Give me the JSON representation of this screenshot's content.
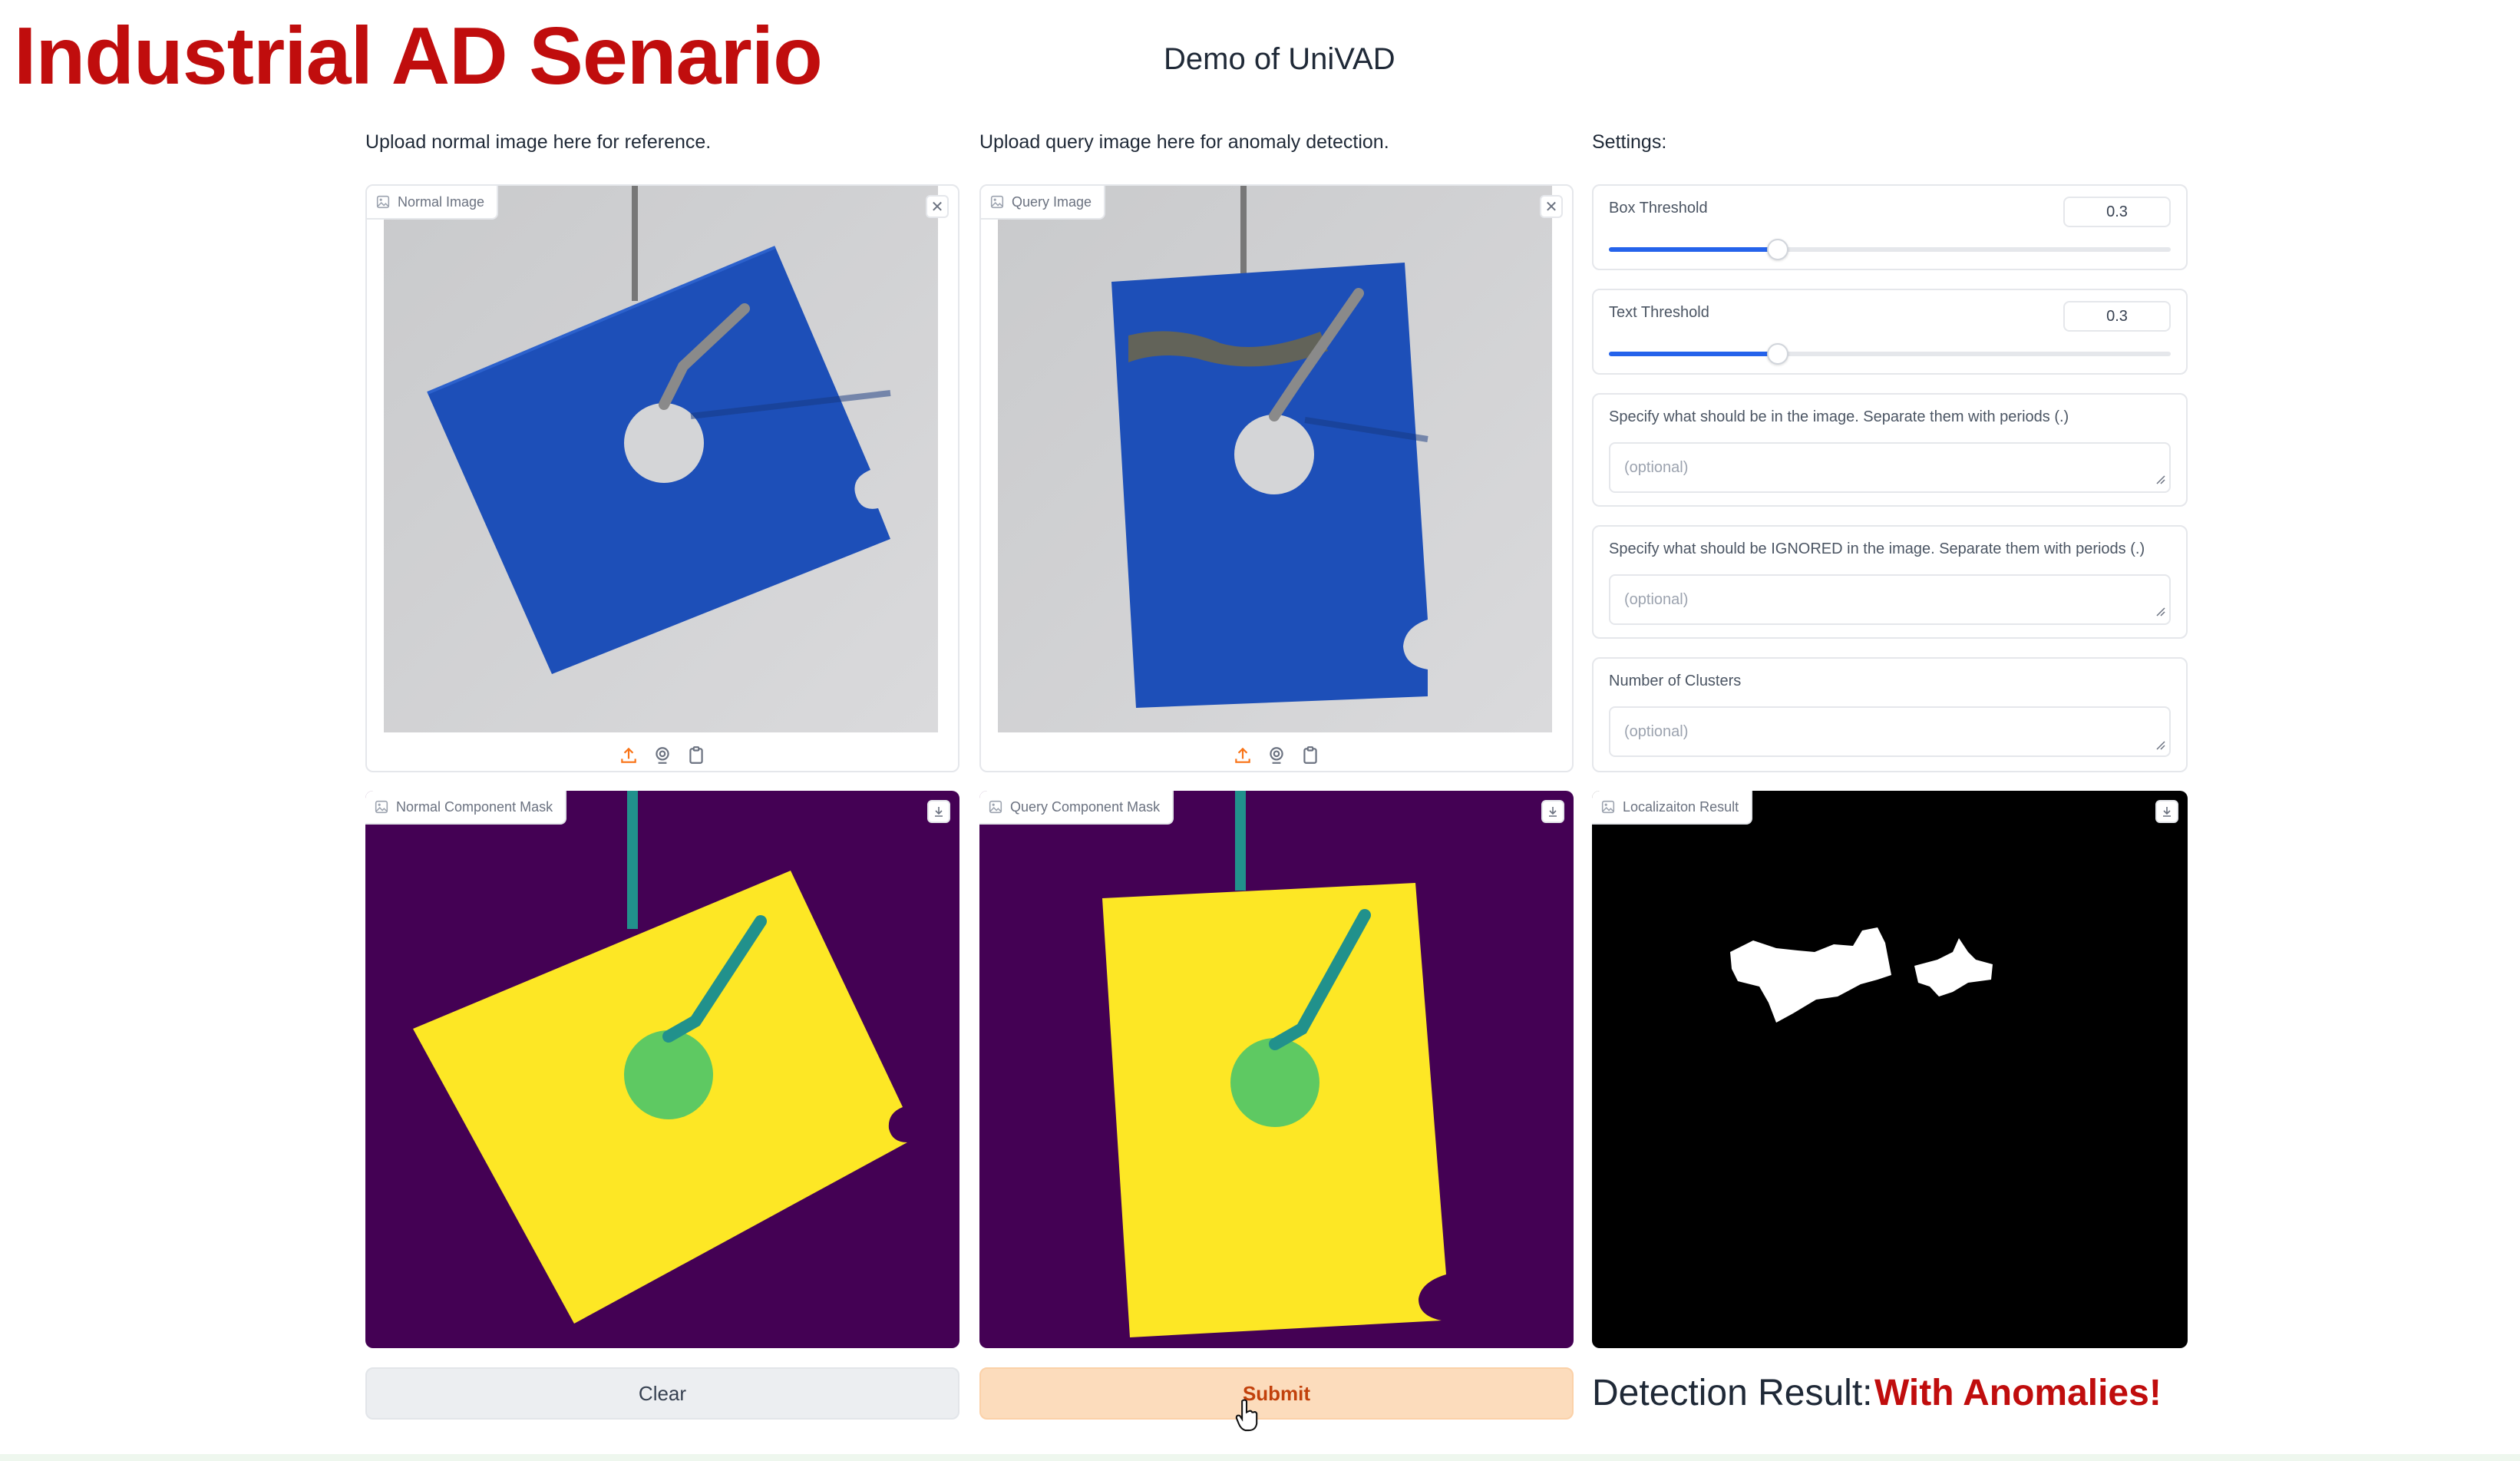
{
  "slide": {
    "title": "Industrial AD Senario"
  },
  "app": {
    "title": "Demo of UniVAD"
  },
  "columns": {
    "reference_heading": "Upload normal image here for reference.",
    "query_heading": "Upload query image here for anomaly detection.",
    "settings_heading": "Settings:"
  },
  "panels": {
    "normal_image": {
      "label": "Normal Image"
    },
    "query_image": {
      "label": "Query Image"
    },
    "normal_mask": {
      "label": "Normal Component Mask"
    },
    "query_mask": {
      "label": "Query Component Mask"
    },
    "localization": {
      "label": "Localizaiton Result"
    }
  },
  "icons": {
    "image": "image-icon",
    "close": "close-icon",
    "upload": "upload-icon",
    "webcam": "webcam-icon",
    "clipboard": "clipboard-icon",
    "download": "download-icon"
  },
  "settings": {
    "box_threshold": {
      "label": "Box Threshold",
      "value": "0.3",
      "level": 0.3
    },
    "text_threshold": {
      "label": "Text Threshold",
      "value": "0.3",
      "level": 0.3
    },
    "include": {
      "label": "Specify what should be in the image. Separate them with periods (.)",
      "placeholder": "(optional)"
    },
    "ignore": {
      "label": "Specify what should be IGNORED in the image. Separate them with periods (.)",
      "placeholder": "(optional)"
    },
    "clusters": {
      "label": "Number of Clusters",
      "placeholder": "(optional)"
    }
  },
  "buttons": {
    "clear": "Clear",
    "submit": "Submit"
  },
  "result": {
    "label": "Detection Result:",
    "value": "With Anomalies!"
  },
  "colors": {
    "title_red": "#c00d0d",
    "slider_blue": "#2563eb",
    "mask_background": "#440154",
    "mask_part": "#fde725",
    "mask_hole": "#5ec962",
    "mask_hanger": "#21918c",
    "plate_blue": "#1d4fb8",
    "submit_bg": "#fcdcbc"
  }
}
